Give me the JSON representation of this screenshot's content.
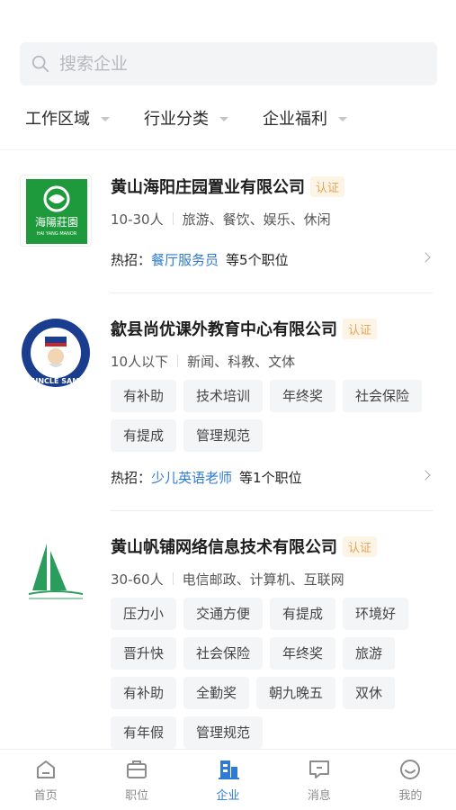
{
  "search": {
    "placeholder": "搜索企业"
  },
  "filters": [
    "工作区域",
    "行业分类",
    "企业福利"
  ],
  "companies": [
    {
      "name": "黄山海阳庄园置业有限公司",
      "badge": "认证",
      "size": "10-30人",
      "industry": "旅游、餐饮、娱乐、休闲",
      "tags": [],
      "hot_prefix": "热招：",
      "hot_job": "餐厅服务员",
      "hot_suffix": "等5个职位",
      "logo_text": "海陽莊園",
      "logo_sub": "HAI YANG MANOR"
    },
    {
      "name": "歙县尚优课外教育中心有限公司",
      "badge": "认证",
      "size": "10人以下",
      "industry": "新闻、科教、文体",
      "tags": [
        "有补助",
        "技术培训",
        "年终奖",
        "社会保险",
        "有提成",
        "管理规范"
      ],
      "hot_prefix": "热招：",
      "hot_job": "少儿英语老师",
      "hot_suffix": "等1个职位",
      "logo_text": "UNCLE SAM"
    },
    {
      "name": "黄山帆铺网络信息技术有限公司",
      "badge": "认证",
      "size": "30-60人",
      "industry": "电信邮政、计算机、互联网",
      "tags": [
        "压力小",
        "交通方便",
        "有提成",
        "环境好",
        "晋升快",
        "社会保险",
        "年终奖",
        "旅游",
        "有补助",
        "全勤奖",
        "朝九晚五",
        "双休",
        "有年假",
        "管理规范"
      ]
    }
  ],
  "tabbar": [
    {
      "label": "首页",
      "icon": "home-icon"
    },
    {
      "label": "职位",
      "icon": "briefcase-icon"
    },
    {
      "label": "企业",
      "icon": "building-icon",
      "active": true
    },
    {
      "label": "消息",
      "icon": "message-icon"
    },
    {
      "label": "我的",
      "icon": "profile-icon"
    }
  ],
  "colors": {
    "accent": "#2e7ad6",
    "badge": "#e0a457"
  }
}
